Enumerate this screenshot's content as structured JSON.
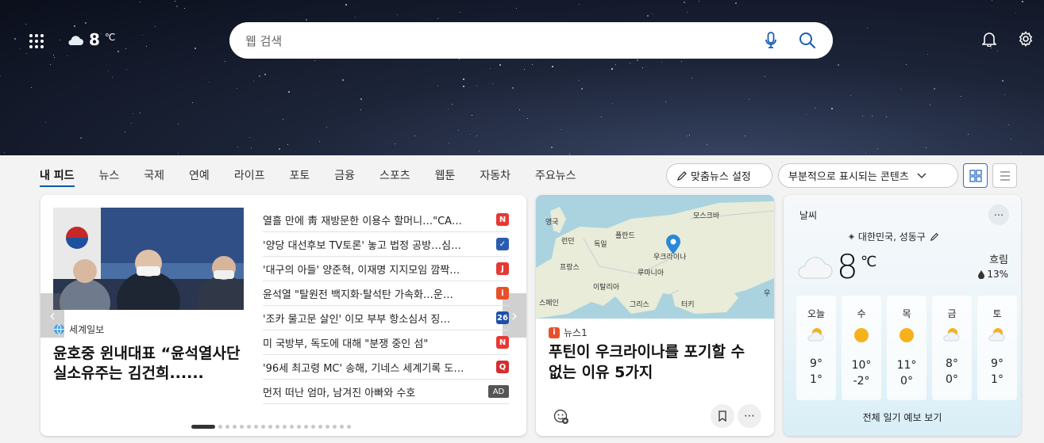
{
  "header": {
    "weather_temp": "8",
    "weather_unit": "℃",
    "search_placeholder": "웹 검색"
  },
  "nav": {
    "tabs": [
      "내 피드",
      "뉴스",
      "국제",
      "연예",
      "라이프",
      "포토",
      "금융",
      "스포츠",
      "웹툰",
      "자동차",
      "주요뉴스"
    ],
    "personalize_label": "맞춤뉴스 설정",
    "content_dropdown_label": "부분적으로 표시되는 콘텐츠"
  },
  "feature_card": {
    "source": "세계일보",
    "headline": "윤호중 윈내대표 “윤석열사단 실소유주는 김건희......",
    "news": [
      {
        "title": "열흘 만에 靑 재방문한 이용수 할머니…\"CA…",
        "badge": "N",
        "color": "#e53935"
      },
      {
        "title": "'양당 대선후보 TV토론' 놓고 법정 공방…심…",
        "badge": "✓",
        "color": "#2a5db0"
      },
      {
        "title": "'대구의 아들' 양준혁, 이재명 지지모임 깜짝…",
        "badge": "J",
        "color": "#e53935"
      },
      {
        "title": "윤석열 \"탈원전 백지화·탈석탄 가속화…운…",
        "badge": "i",
        "color": "#e8502a"
      },
      {
        "title": "'조카 물고문 살인' 이모 부부 항소심서 징…",
        "badge": "26",
        "color": "#1e4fa8"
      },
      {
        "title": "미 국방부, 독도에 대해 \"분쟁 중인 섬\"",
        "badge": "N",
        "color": "#e53935"
      },
      {
        "title": "'96세 최고령 MC' 송해, 기네스 세계기록 도…",
        "badge": "Q",
        "color": "#d32f2f"
      },
      {
        "title": "먼저 떠난 엄마, 남겨진 아빠와 수호",
        "badge": "AD",
        "color": "#555555"
      }
    ]
  },
  "map_card": {
    "source": "뉴스1",
    "headline": "푸틴이 우크라이나를 포기할 수 없는 이유 5가지",
    "labels": [
      "영국",
      "모스크바",
      "런던",
      "독일",
      "폴란드",
      "프랑스",
      "우크라이나",
      "이탈리아",
      "루마니아",
      "스페인",
      "그리스",
      "터키",
      "우"
    ]
  },
  "weather_card": {
    "title": "날씨",
    "location": "대한민국, 성동구",
    "temp": "8",
    "unit": "℃",
    "condition": "흐림",
    "humidity": "13%",
    "days": [
      {
        "name": "오늘",
        "hi": "9°",
        "lo": "1°",
        "icon": "partly-cloudy"
      },
      {
        "name": "수",
        "hi": "10°",
        "lo": "-2°",
        "icon": "sunny"
      },
      {
        "name": "목",
        "hi": "11°",
        "lo": "0°",
        "icon": "sunny"
      },
      {
        "name": "금",
        "hi": "8°",
        "lo": "0°",
        "icon": "partly-cloudy"
      },
      {
        "name": "토",
        "hi": "9°",
        "lo": "1°",
        "icon": "partly-cloudy"
      }
    ],
    "forecast_link": "전체 일기 예보 보기"
  }
}
